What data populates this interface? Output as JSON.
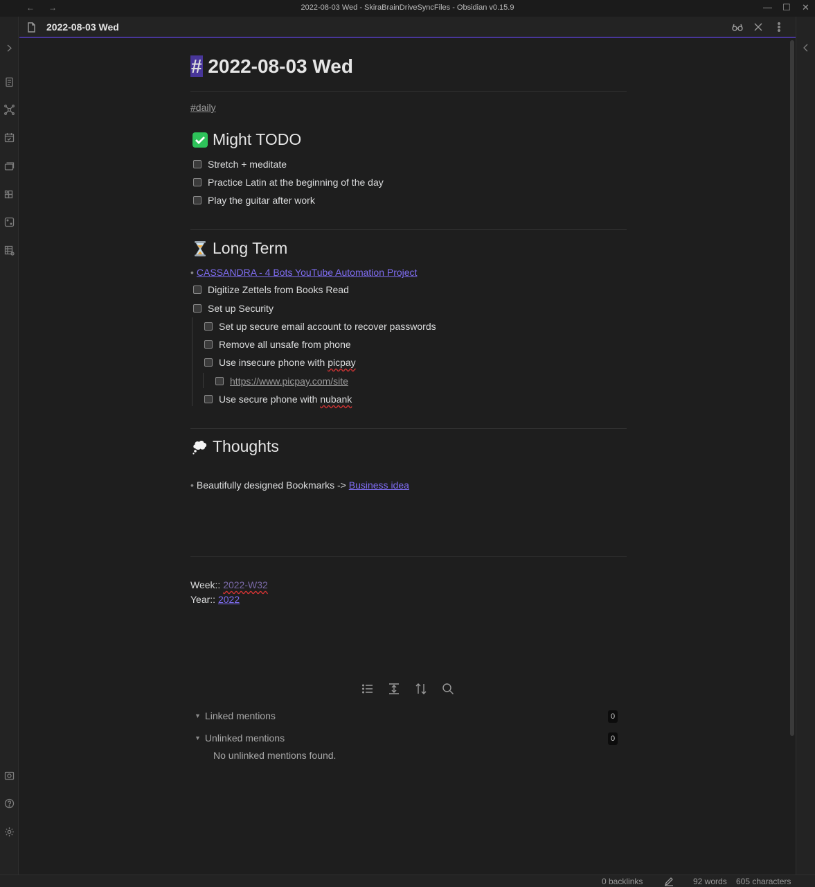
{
  "window": {
    "title": "2022-08-03 Wed - SkiraBrainDriveSyncFiles - Obsidian v0.15.9",
    "back": "←",
    "forward": "→",
    "minimize": "—",
    "maximize": "☐",
    "close": "✕"
  },
  "tab": {
    "title": "2022-08-03 Wed"
  },
  "note": {
    "heading_hash": "#",
    "heading": "2022-08-03 Wed",
    "tag": "#daily",
    "sections": {
      "todo": {
        "title": "Might TODO",
        "tasks": [
          "Stretch + meditate",
          "Practice Latin at the beginning of the day",
          "Play the guitar after work"
        ]
      },
      "longterm": {
        "title": "Long Term",
        "link": "CASSANDRA - 4 Bots YouTube Automation Project",
        "tasks": [
          "Digitize Zettels from Books Read",
          "Set up Security"
        ],
        "subtasks": [
          "Set up secure email account to recover passwords",
          "Remove all unsafe from phone"
        ],
        "picpay_prefix": "Use insecure phone with ",
        "picpay_word": "picpay",
        "picpay_url": "https://www.picpay.com/site",
        "nubank_prefix": "Use secure phone with ",
        "nubank_word": "nubank"
      },
      "thoughts": {
        "title": "Thoughts",
        "bullet_text": "Beautifully designed Bookmarks -> ",
        "bullet_link": "Business idea"
      }
    },
    "week_label": "Week:: ",
    "week_value": "2022-W32",
    "year_label": "Year:: ",
    "year_value": "2022"
  },
  "backlinks": {
    "linked_label": "Linked mentions",
    "linked_count": "0",
    "unlinked_label": "Unlinked mentions",
    "unlinked_count": "0",
    "empty_text": "No unlinked mentions found."
  },
  "status": {
    "backlinks": "0 backlinks",
    "words": "92 words",
    "characters": "605 characters"
  },
  "colors": {
    "accent": "#483699",
    "link": "#7f6df2"
  }
}
